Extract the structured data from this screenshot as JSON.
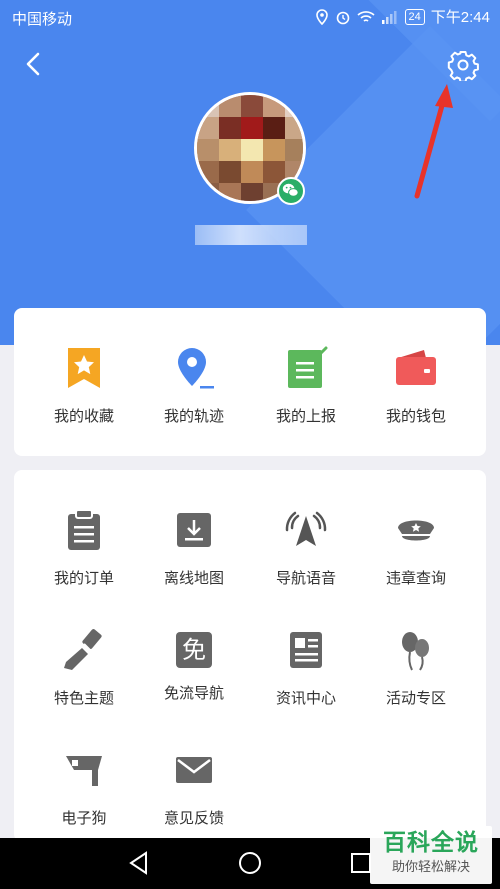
{
  "status_bar": {
    "carrier": "中国移动",
    "battery": "24",
    "time": "下午2:44"
  },
  "header": {
    "back_icon": "chevron-left-icon",
    "settings_icon": "gear-icon",
    "avatar_badge_icon": "wechat-icon",
    "bg_color": "#4a86ee"
  },
  "quick_actions": [
    {
      "label": "我的收藏",
      "icon": "star-bookmark-icon",
      "color": "#f5a623"
    },
    {
      "label": "我的轨迹",
      "icon": "location-pin-icon",
      "color": "#4a86ee"
    },
    {
      "label": "我的上报",
      "icon": "report-note-icon",
      "color": "#5cb85c"
    },
    {
      "label": "我的钱包",
      "icon": "wallet-icon",
      "color": "#f05a5a"
    }
  ],
  "tools": [
    {
      "label": "我的订单",
      "icon": "clipboard-icon"
    },
    {
      "label": "离线地图",
      "icon": "download-map-icon"
    },
    {
      "label": "导航语音",
      "icon": "voice-broadcast-icon"
    },
    {
      "label": "违章查询",
      "icon": "police-cap-icon"
    },
    {
      "label": "特色主题",
      "icon": "paint-brush-icon"
    },
    {
      "label": "免流导航",
      "icon": "free-data-icon",
      "glyph": "免"
    },
    {
      "label": "资讯中心",
      "icon": "news-icon"
    },
    {
      "label": "活动专区",
      "icon": "balloons-icon"
    },
    {
      "label": "电子狗",
      "icon": "speed-camera-icon"
    },
    {
      "label": "意见反馈",
      "icon": "envelope-icon"
    }
  ],
  "nav": {
    "back": "back-triangle-icon",
    "home": "home-circle-icon",
    "recent": "recent-square-icon"
  },
  "watermark": {
    "title": "百科全说",
    "subtitle": "助你轻松解决"
  }
}
